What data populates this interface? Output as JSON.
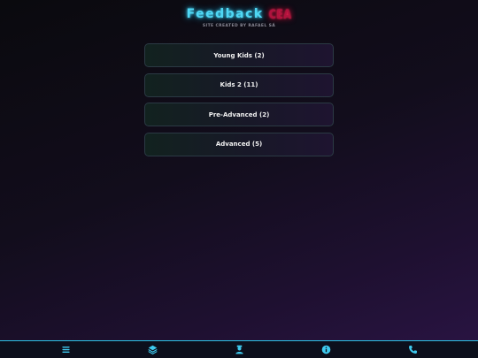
{
  "header": {
    "title": "Feedback",
    "logo_text": "CEA",
    "subtitle": "SITE CREATED BY RAFAEL SÁ"
  },
  "menu": {
    "items": [
      {
        "label": "Young Kids (2)"
      },
      {
        "label": "Kids 2 (11)"
      },
      {
        "label": "Pre-Advanced (2)"
      },
      {
        "label": "Advanced (5)"
      }
    ]
  },
  "bottom_nav": {
    "icons": [
      "menu-icon",
      "layers-icon",
      "teacher-icon",
      "info-icon",
      "phone-icon"
    ],
    "accent_color": "#2ec3e6"
  },
  "colors": {
    "title": "#4fd8f5",
    "logo": "#ff2a55",
    "item_border": "#2b3a44"
  }
}
